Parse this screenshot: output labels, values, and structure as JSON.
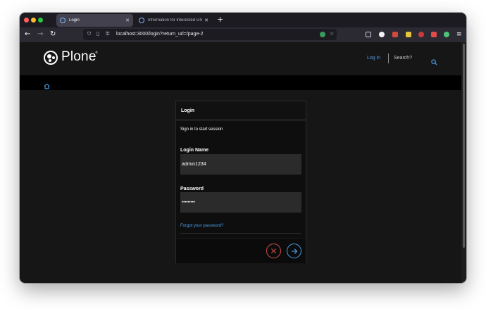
{
  "browser": {
    "tabs": [
      {
        "title": "Login",
        "active": true
      },
      {
        "title": "Information for Interested GSoC...",
        "active": false
      }
    ],
    "url": "localhost:3000/login?return_url=/page-2"
  },
  "site": {
    "logo_text": "Plone",
    "logo_reg": "®",
    "nav": {
      "login": "Log in",
      "search_placeholder": "Search?"
    }
  },
  "login": {
    "title": "Login",
    "description": "Sign in to start session",
    "login_name_label": "Login Name",
    "login_name_value": "admin1234",
    "password_label": "Password",
    "password_value": "•••••••••",
    "forgot_link": "Forgot your password?"
  },
  "colors": {
    "accent": "#4d9ee8",
    "cancel": "#d4504c",
    "background": "#161616"
  }
}
